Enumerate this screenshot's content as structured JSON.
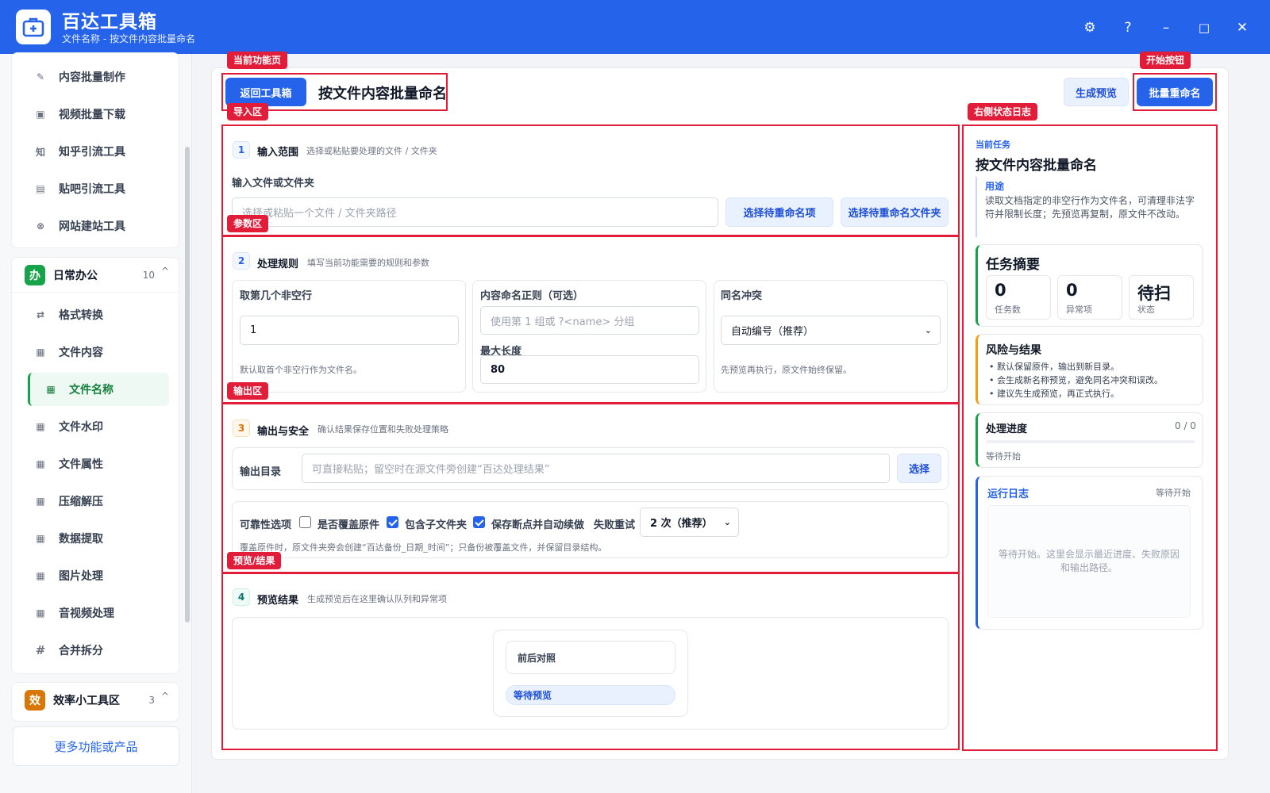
{
  "app": {
    "name": "百达工具箱",
    "subtitle": "文件名称 - 按文件内容批量命名"
  },
  "window": {
    "settings": "⚙",
    "help": "?",
    "minimize": "–",
    "maximize": "□",
    "close": "✕"
  },
  "sidebar": {
    "top_items": [
      {
        "label": "内容批量制作",
        "icon": "✎"
      },
      {
        "label": "视频批量下载",
        "icon": "▣"
      },
      {
        "label": "知乎引流工具",
        "icon": "知"
      },
      {
        "label": "贴吧引流工具",
        "icon": "▤"
      },
      {
        "label": "网站建站工具",
        "icon": "⊗"
      }
    ],
    "group_office": {
      "badge": "办",
      "title": "日常办公",
      "count": "10",
      "chevron": "^"
    },
    "office_items": [
      {
        "label": "格式转换",
        "icon": "⇄"
      },
      {
        "label": "文件内容",
        "icon": "▦"
      },
      {
        "label": "文件名称",
        "icon": "▦"
      },
      {
        "label": "文件水印",
        "icon": "▦"
      },
      {
        "label": "文件属性",
        "icon": "▦"
      },
      {
        "label": "压缩解压",
        "icon": "▦"
      },
      {
        "label": "数据提取",
        "icon": "▦"
      },
      {
        "label": "图片处理",
        "icon": "▦"
      },
      {
        "label": "音视频处理",
        "icon": "▦"
      },
      {
        "label": "合并拆分",
        "icon": "#"
      }
    ],
    "group_efficiency": {
      "badge": "效",
      "title": "效率小工具区",
      "count": "3",
      "chevron": "^"
    },
    "more_button": "更多功能或产品"
  },
  "toolbar": {
    "back": "返回工具箱",
    "title": "按文件内容批量命名",
    "preview": "生成预览",
    "start": "批量重命名"
  },
  "annotations": {
    "current_page": "当前功能页",
    "start_button": "开始按钮",
    "import": "导入区",
    "status_log": "右侧状态日志",
    "params": "参数区",
    "output": "输出区",
    "preview": "预览/结果"
  },
  "section1": {
    "step": "1",
    "title": "输入范围",
    "desc": "选择或粘贴要处理的文件 / 文件夹",
    "field_label": "输入文件或文件夹",
    "placeholder": "选择或粘贴一个文件 / 文件夹路径",
    "btn_item": "选择待重命名项",
    "btn_folder": "选择待重命名文件夹"
  },
  "section2": {
    "step": "2",
    "title": "处理规则",
    "desc": "填写当前功能需要的规则和参数",
    "col1": {
      "label": "取第几个非空行",
      "value": "1",
      "hint": "默认取首个非空行作为文件名。"
    },
    "col2": {
      "label": "内容命名正则（可选）",
      "placeholder": "使用第 1 组或 ?<name> 分组",
      "max_label": "最大长度",
      "max_value": "80"
    },
    "col3": {
      "label": "同名冲突",
      "selected": "自动编号（推荐）",
      "hint": "先预览再执行，原文件始终保留。"
    }
  },
  "section3": {
    "step": "3",
    "title": "输出与安全",
    "desc": "确认结果保存位置和失败处理策略",
    "dir_label": "输出目录",
    "dir_placeholder": "可直接粘贴；留空时在源文件旁创建“百达处理结果”",
    "dir_btn": "选择",
    "reliability_label": "可靠性选项",
    "opt_overwrite": "是否覆盖原件",
    "opt_subfolders": "包含子文件夹",
    "opt_resume": "保存断点并自动续做",
    "retry_label": "失败重试",
    "retry_selected": "2 次（推荐）",
    "note": "覆盖原件时，原文件夹旁会创建“百达备份_日期_时间”；只备份被覆盖文件，并保留目录结构。"
  },
  "section4": {
    "step": "4",
    "title": "预览结果",
    "desc": "生成预览后在这里确认队列和异常项",
    "compare": "前后对照",
    "waiting": "等待预览"
  },
  "panel": {
    "task_label": "当前任务",
    "task_title": "按文件内容批量命名",
    "purpose_label": "用途",
    "purpose_text": "读取文档指定的非空行作为文件名，可清理非法字符并限制长度；先预览再复制，原文件不改动。",
    "summary_title": "任务摘要",
    "stats": [
      {
        "num": "0",
        "label": "任务数"
      },
      {
        "num": "0",
        "label": "异常项"
      },
      {
        "num": "待扫",
        "label": "状态"
      }
    ],
    "risk_title": "风险与结果",
    "risks": [
      "默认保留原件，输出到新目录。",
      "会生成新名称预览，避免同名冲突和误改。",
      "建议先生成预览，再正式执行。"
    ],
    "progress_title": "处理进度",
    "progress_count": "0 / 0",
    "progress_status": "等待开始",
    "progress_fraction": 0,
    "log_title": "运行日志",
    "log_status": "等待开始",
    "log_empty": "等待开始。这里会显示最近进度、失败原因和输出路径。"
  },
  "colors": {
    "primary": "#2563eb",
    "annotation": "#e11d3a",
    "office_badge": "#16a34a",
    "efficiency_badge": "#d97706",
    "risk_accent": "#f59e0b",
    "progress_accent": "#16a34a",
    "log_accent": "#2563eb"
  }
}
